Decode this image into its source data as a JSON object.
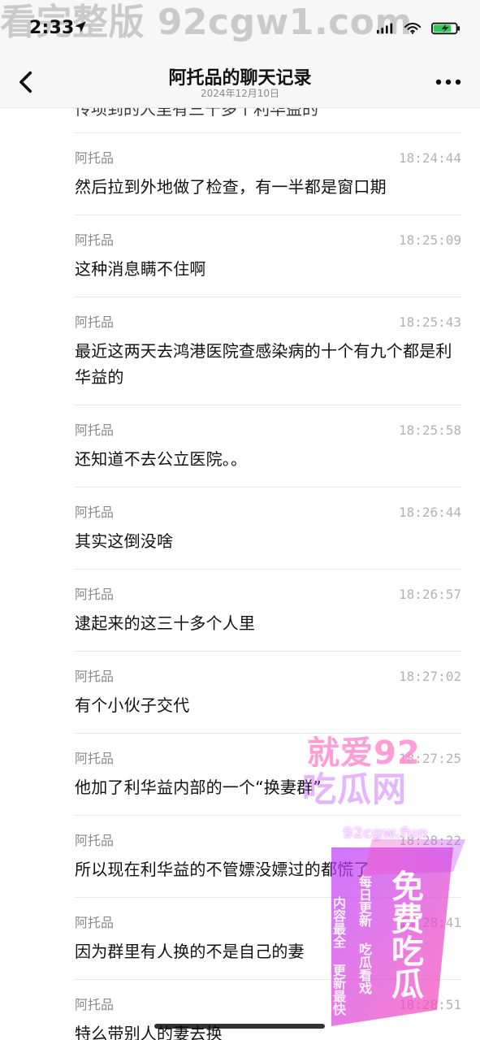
{
  "top_watermark": "看完整版 92cgw1.com",
  "status": {
    "time": "2:33",
    "location_icon": "location-arrow-icon",
    "signal_icon": "cellular-signal-icon",
    "wifi_icon": "wifi-icon",
    "battery_icon": "battery-charging-icon"
  },
  "nav": {
    "back_icon": "chevron-left-icon",
    "title": "阿托品的聊天记录",
    "subtitle": "2024年12月10日",
    "more_icon": "more-horizontal-icon"
  },
  "chat": {
    "partial_top_text": "传项到的人里有三十多个利华益的",
    "messages": [
      {
        "sender": "阿托品",
        "time": "18:24:44",
        "text": "然后拉到外地做了检查，有一半都是窗口期"
      },
      {
        "sender": "阿托品",
        "time": "18:25:09",
        "text": "这种消息瞒不住啊"
      },
      {
        "sender": "阿托品",
        "time": "18:25:43",
        "text": "最近这两天去鸿港医院查感染病的十个有九个都是利华益的"
      },
      {
        "sender": "阿托品",
        "time": "18:25:58",
        "text": "还知道不去公立医院。。"
      },
      {
        "sender": "阿托品",
        "time": "18:26:44",
        "text": "其实这倒没啥"
      },
      {
        "sender": "阿托品",
        "time": "18:26:57",
        "text": "逮起来的这三十多个人里"
      },
      {
        "sender": "阿托品",
        "time": "18:27:02",
        "text": "有个小伙子交代"
      },
      {
        "sender": "阿托品",
        "time": "18:27:25",
        "text": "他加了利华益内部的一个“换妻群”"
      },
      {
        "sender": "阿托品",
        "time": "18:28:22",
        "text": "所以现在利华益的不管嫖没嫖过的都慌了"
      },
      {
        "sender": "阿托品",
        "time": "18:28:41",
        "text": "因为群里有人换的不是自己的妻"
      },
      {
        "sender": "阿托品",
        "time": "18:28:51",
        "text": "特么带别人的妻去换"
      }
    ]
  },
  "watermark": {
    "line1": "就爱92",
    "line2": "吃瓜网",
    "url": "92cgw.fun",
    "vertical_big": "免费吃瓜",
    "vertical_mid": "每日更新 吃瓜看戏",
    "vertical_small": "内容最全 更新最快"
  }
}
